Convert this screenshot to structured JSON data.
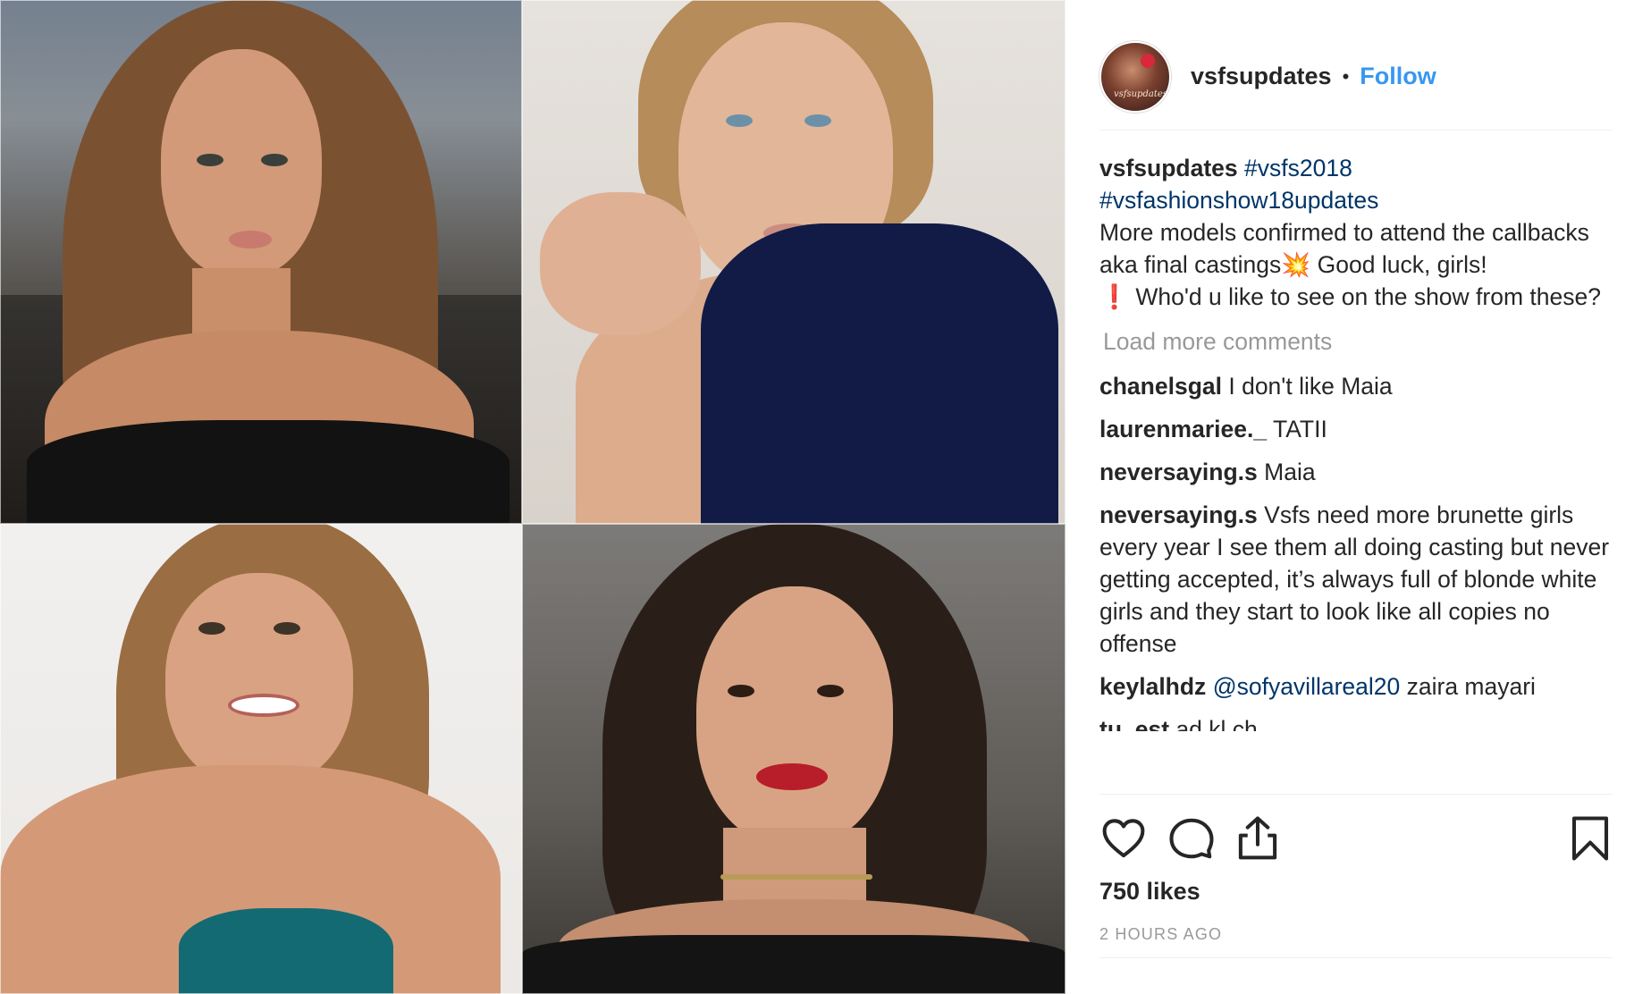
{
  "post": {
    "username": "vsfsupdates",
    "separator": "•",
    "follow_label": "Follow",
    "avatar_script": "vsfsupdates"
  },
  "caption": {
    "username": "vsfsupdates",
    "hashtag_1": "#vsfs2018",
    "hashtag_2": "#vsfashionshow18updates",
    "text_1": "More models confirmed to attend the callbacks aka final castings💥 Good luck, girls!",
    "text_2": "❗ Who'd u like to see on the show from these?"
  },
  "load_more_label": "Load more comments",
  "comments": [
    {
      "username": "chanelsgal",
      "text": "I don't like Maia"
    },
    {
      "username": "laurenmariee._",
      "text": "TATII"
    },
    {
      "username": "neversaying.s",
      "text": "Maia"
    },
    {
      "username": "neversaying.s",
      "text": "Vsfs need more brunette girls every year I see them all doing casting but never getting accepted, it’s always full of blonde white girls and they start to look like all copies no offense"
    },
    {
      "username": "keylalhdz",
      "mention": "@sofyavillareal20",
      "text": "zaira mayari"
    },
    {
      "username": "tu_est",
      "text": "ad kl ch"
    }
  ],
  "likes_label": "750 likes",
  "time_ago": "2 HOURS AGO",
  "icons": {
    "like": "heart-icon",
    "comment": "comment-bubble-icon",
    "share": "share-icon",
    "save": "bookmark-icon"
  },
  "colors": {
    "follow": "#3897f0",
    "hashtag": "#003569",
    "muted": "#999999",
    "text": "#262626",
    "divider": "#efefef"
  }
}
